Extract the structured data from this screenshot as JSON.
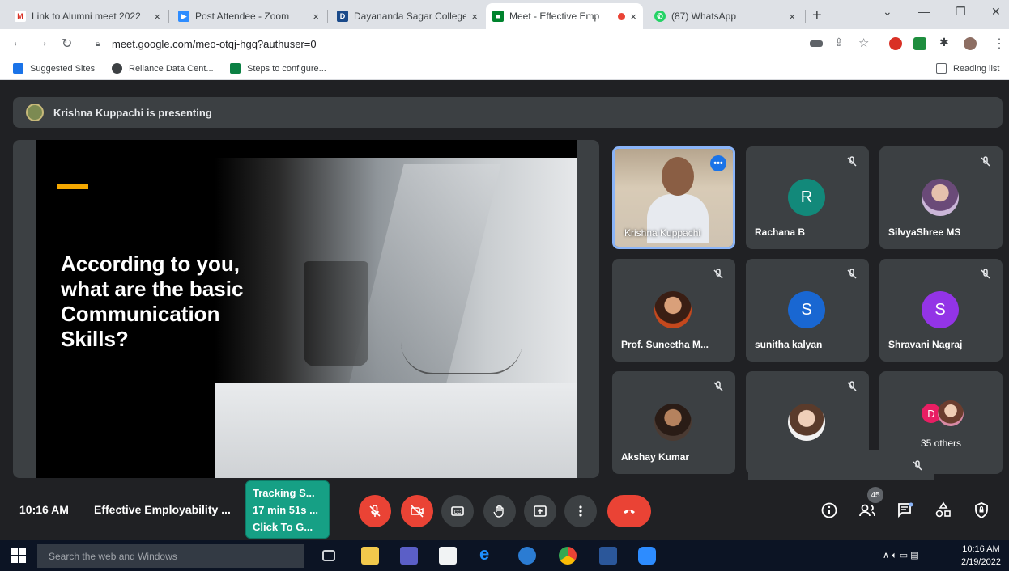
{
  "browser": {
    "tabs": [
      {
        "label": "Link to Alumni meet 2022",
        "close": "×"
      },
      {
        "label": "Post Attendee - Zoom",
        "close": "×"
      },
      {
        "label": "Dayananda Sagar College",
        "close": "×"
      },
      {
        "label": "Meet - Effective Emp",
        "close": "×"
      },
      {
        "label": "(87) WhatsApp",
        "close": "×"
      }
    ],
    "new_tab": "+",
    "url": "meet.google.com/meo-otqj-hgq?authuser=0",
    "bookmarks": [
      "Suggested Sites",
      "Reliance Data Cent...",
      "Steps to configure..."
    ],
    "reading_list": "Reading list"
  },
  "meet": {
    "presenting_banner": "Krishna Kuppachi is presenting",
    "slide": {
      "question": "According to you, what are the basic Communication Skills?"
    },
    "tiles": [
      {
        "name": "Krishna Kuppachi",
        "type": "video"
      },
      {
        "name": "Rachana B",
        "initial": "R",
        "color": "#12897a"
      },
      {
        "name": "SilvyaShree MS",
        "type": "photo"
      },
      {
        "name": "Prof. Suneetha M...",
        "type": "photo"
      },
      {
        "name": "sunitha kalyan",
        "initial": "S",
        "color": "#1967d2"
      },
      {
        "name": "Shravani Nagraj",
        "initial": "S",
        "color": "#9334e6"
      },
      {
        "name": "Akshay Kumar",
        "type": "photo"
      },
      {
        "name": "",
        "type": "photo"
      },
      {
        "name": "35 others",
        "initial": "D"
      }
    ],
    "bottom": {
      "time": "10:16 AM",
      "meeting_title": "Effective Employability ...",
      "tracker_lines": [
        "Tracking S...",
        "17 min 51s ...",
        "Click To G..."
      ],
      "participants_count": "45"
    }
  },
  "taskbar": {
    "search_placeholder": "Search the web and Windows",
    "time": "10:16 AM",
    "date": "2/19/2022"
  }
}
